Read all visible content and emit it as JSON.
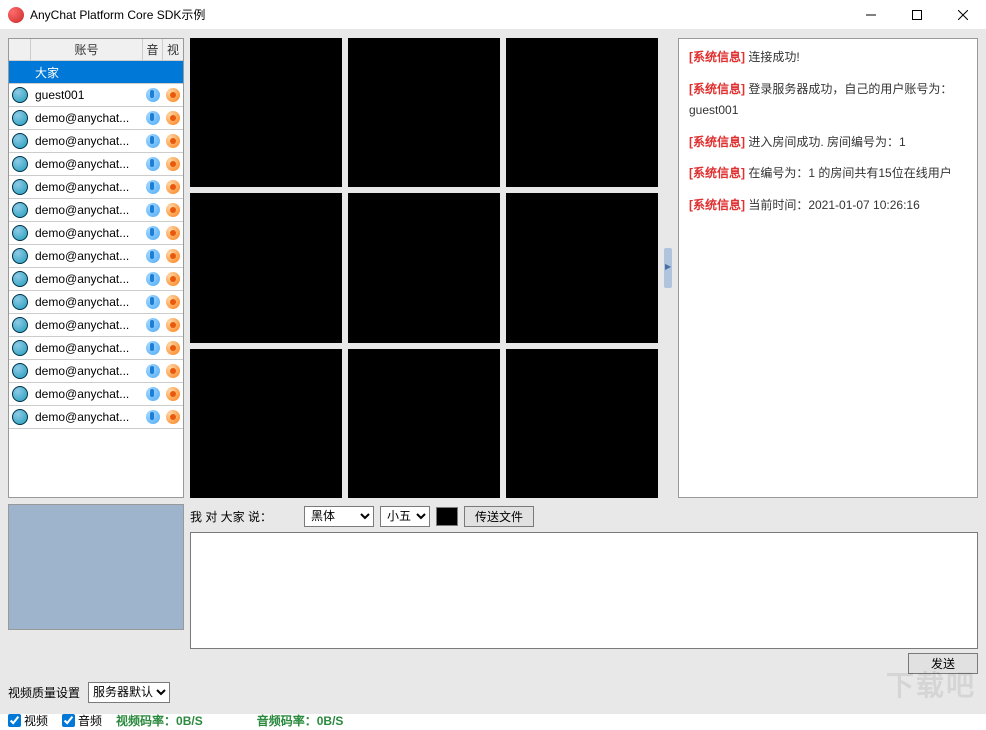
{
  "window": {
    "title": "AnyChat Platform Core SDK示例"
  },
  "userlist": {
    "headers": {
      "name": "账号",
      "audio": "音",
      "video": "视"
    },
    "rows": [
      {
        "name": "大家",
        "selected": true,
        "noAvatar": true,
        "noIcons": true
      },
      {
        "name": "guest001"
      },
      {
        "name": "demo@anychat..."
      },
      {
        "name": "demo@anychat..."
      },
      {
        "name": "demo@anychat..."
      },
      {
        "name": "demo@anychat..."
      },
      {
        "name": "demo@anychat..."
      },
      {
        "name": "demo@anychat..."
      },
      {
        "name": "demo@anychat..."
      },
      {
        "name": "demo@anychat..."
      },
      {
        "name": "demo@anychat..."
      },
      {
        "name": "demo@anychat..."
      },
      {
        "name": "demo@anychat..."
      },
      {
        "name": "demo@anychat..."
      },
      {
        "name": "demo@anychat..."
      },
      {
        "name": "demo@anychat..."
      }
    ]
  },
  "log": {
    "tag": "[系统信息]",
    "lines": [
      {
        "text": "连接成功!"
      },
      {
        "text": "登录服务器成功，自己的用户账号为：guest001"
      },
      {
        "text": "进入房间成功. 房间编号为：1"
      },
      {
        "text": "在编号为：1 的房间共有15位在线用户"
      },
      {
        "text": "当前时间：2021-01-07 10:26:16"
      }
    ]
  },
  "chat": {
    "prefix": "我 对 大家 说：",
    "font_options": [
      "黑体"
    ],
    "font_value": "黑体",
    "size_options": [
      "小五"
    ],
    "size_value": "小五",
    "file_btn": "传送文件",
    "send_btn": "发送"
  },
  "settings": {
    "label": "视频质量设置",
    "options": [
      "服务器默认"
    ],
    "value": "服务器默认"
  },
  "status": {
    "video_chk": "视频",
    "audio_chk": "音频",
    "video_rate_label": "视频码率：",
    "video_rate_value": "0B/S",
    "audio_rate_label": "音频码率：",
    "audio_rate_value": "0B/S"
  },
  "watermark": "下载吧"
}
